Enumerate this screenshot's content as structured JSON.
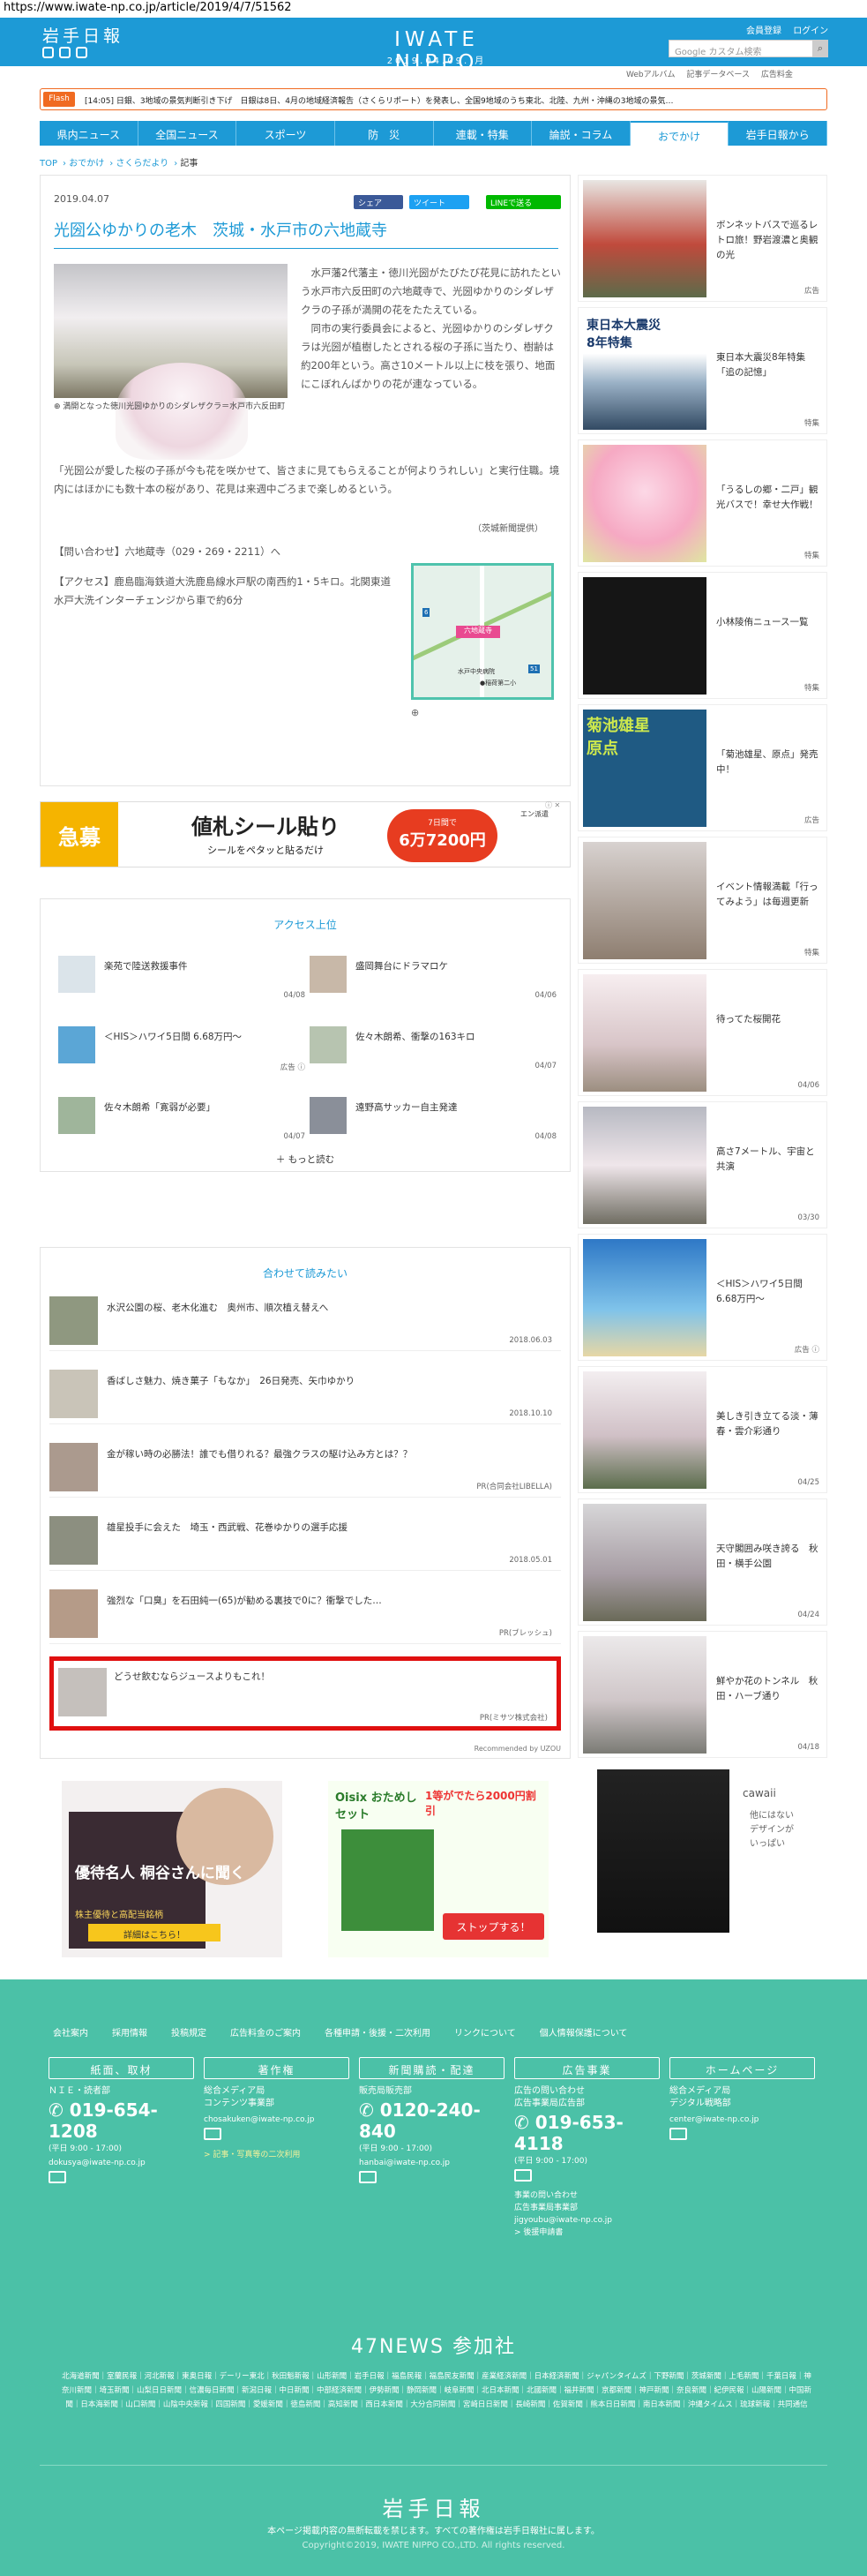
{
  "url": "https://www.iwate-np.co.jp/article/2019/4/7/51562",
  "header": {
    "logo": "岩手日報",
    "brand": "IWATE NIPPO",
    "date": "2019.04.09. 月",
    "account": [
      "会員登録",
      "ログイン"
    ],
    "search_placeholder": "Google カスタム検索",
    "subnav": [
      "Webアルバム",
      "記事データベース",
      "広告料金"
    ]
  },
  "flash": {
    "tag": "Flash",
    "text": "[14:05] 日銀、3地域の景気判断引き下げ　日銀は8日、4月の地域経済報告（さくらリポート）を発表し、全国9地域のうち東北、北陸、九州・沖縄の3地域の景気…"
  },
  "nav": [
    "県内ニュース",
    "全国ニュース",
    "スポーツ",
    "防　災",
    "連載・特集",
    "論説・コラム",
    "おでかけ",
    "岩手日報から"
  ],
  "breadcrumb": [
    "TOP",
    "おでかけ",
    "さくらだより",
    "記事"
  ],
  "article": {
    "date": "2019.04.07",
    "share": [
      "シェア",
      "ツイート",
      "LINEで送る"
    ],
    "title": "光圀公ゆかりの老木　茨城・水戸市の六地蔵寺",
    "photo_caption": "満開となった徳川光圀ゆかりのシダレザクラ＝水戸市六反田町",
    "body1": "　水戸藩2代藩主・徳川光圀がたびたび花見に訪れたという水戸市六反田町の六地蔵寺で、光圀ゆかりのシダレザクラの子孫が満開の花をたたえている。\n　同市の実行委員会によると、光圀ゆかりのシダレザクラは光圀が植樹したとされる桜の子孫に当たり、樹齢は約200年という。高さ10メートル以上に枝を張り、地面にこぼれんばかりの花が連なっている。",
    "body2": "「光圀公が愛した桜の子孫が今も花を咲かせて、皆さまに見てもらえることが何よりうれしい」と実行住職。境内にはほかにも数十本の桜があり、花見は来週中ごろまで楽しめるという。",
    "credit": "（茨城新聞提供）",
    "contact": "【問い合わせ】六地蔵寺（029・269・2211）へ",
    "access": "【アクセス】鹿島臨海鉄道大洗鹿島線水戸駅の南西約1・5キロ。北関東道水戸大洗インターチェンジから車で約6分",
    "map_marker": "六地蔵寺",
    "map_labels": [
      "水戸中央病院",
      "●稲荷第二小",
      "6",
      "51"
    ]
  },
  "ad1": {
    "tag": "急募",
    "main": "値札シール貼り",
    "sub": "シールをペタッと貼るだけ",
    "price_small": "7日間で",
    "price": "6万7200円",
    "logo": "エン派遣"
  },
  "ranking": {
    "title": "アクセス上位",
    "items": [
      {
        "text": "楽苑で陸送救援事件",
        "date": "04/08"
      },
      {
        "text": "盛岡舞台にドラマロケ",
        "date": "04/06"
      },
      {
        "text": "＜HIS＞ハワイ5日間 6.68万円〜",
        "date": "広告 ⓘ"
      },
      {
        "text": "佐々木朗希、衝撃の163キロ",
        "date": "04/07"
      },
      {
        "text": "佐々木朗希「寛弱が必要」",
        "date": "04/07"
      },
      {
        "text": "遠野高サッカー自主発達",
        "date": "04/08"
      }
    ],
    "more": "もっと読む"
  },
  "recs": {
    "title": "合わせて読みたい",
    "items": [
      {
        "text": "水沢公園の桜、老木化進む　奥州市、順次植え替えへ",
        "meta": "2018.06.03"
      },
      {
        "text": "香ばしさ魅力、焼き菓子「もなか」　26日発売、矢巾ゆかり",
        "meta": "2018.10.10"
      },
      {
        "text": "金が稼い時の必勝法！誰でも借りれる？最強クラスの駆け込み方とは？？",
        "meta": "PR(合同会社LIBELLA)"
      },
      {
        "text": "雄星投手に会えた　埼玉・西武戦、花巻ゆかりの選手応援",
        "meta": "2018.05.01"
      },
      {
        "text": "強烈な「口臭」を石田純一(65)が勧める裏技で0に？衝撃でした…",
        "meta": "PR(ブレッシュ)"
      },
      {
        "text": "どうせ飲むならジュースよりもこれ！",
        "meta": "PR(ミサツ株式会社)"
      }
    ],
    "recommended": "Recommended by UZOU"
  },
  "ads_bottom": [
    {
      "title": "優待名人 桐谷さんに聞く",
      "sub": "株主優待と高配当銘柄",
      "cta": "詳細はこちら！"
    },
    {
      "title": "Oisix おためしセット",
      "sub": "1等がでたら2000円割引",
      "cta": "ストップする！"
    },
    {
      "title": "cawaii",
      "sub": "他にはないデザインがいっぱい"
    }
  ],
  "sidebar": [
    {
      "text": "ボンネットバスで巡るレトロ旅！野岩渡濃と奥観の光",
      "date": "広告"
    },
    {
      "text": "東日本大震災8年特集「追の記憶」",
      "date": "特集"
    },
    {
      "text": "「うるしの郷・二戸」観光バスで！幸せ大作戦！",
      "date": "特集"
    },
    {
      "text": "小林陵侑ニュース一覧",
      "date": "特集"
    },
    {
      "text": "「菊池雄星、原点」発売中！",
      "date": "広告"
    },
    {
      "text": "イベント情報満載「行ってみよう」は毎週更新",
      "date": "特集"
    },
    {
      "text": "待ってた桜開花",
      "date": "04/06"
    },
    {
      "text": "高さ7メートル、宇宙と共演",
      "date": "03/30"
    },
    {
      "text": "＜HIS＞ハワイ5日間 6.68万円〜",
      "date": "広告 ⓘ"
    },
    {
      "text": "美しき引き立てる淡・薄春・雲介彩通り",
      "date": "04/25"
    },
    {
      "text": "天守閣囲み咲き誇る　秋田・横手公園",
      "date": "04/24"
    },
    {
      "text": "鮮やか花のトンネル　秋田・ハーブ通り",
      "date": "04/18"
    }
  ],
  "sidebar_titles": [
    "東日本大震災\n8年特集",
    "菊池雄星\n原点"
  ],
  "footer": {
    "links": [
      "会社案内",
      "採用情報",
      "投稿規定",
      "広告料金のご案内",
      "各種申請・後援・二次利用",
      "リンクについて",
      "個人情報保護について"
    ],
    "boxes": [
      {
        "head": "紙面、取材",
        "line": "ＮＩＥ・読者部",
        "tel": "019-654-1208",
        "hours": "(平日 9:00 - 17:00)",
        "mail": "dokusya@iwate-np.co.jp"
      },
      {
        "head": "著作権",
        "line": "総合メディア局\nコンテンツ事業部",
        "tel": "",
        "hours": "",
        "mail": "chosakuken@iwate-np.co.jp",
        "extra": "> 記事・写真等の二次利用"
      },
      {
        "head": "新聞購読・配達",
        "line": "販売局販売部",
        "tel": "0120-240-840",
        "hours": "(平日 9:00 - 17:00)",
        "mail": "hanbai@iwate-np.co.jp"
      },
      {
        "head": "広告事業",
        "line": "広告の問い合わせ\n広告事業局広告部",
        "tel": "019-653-4118",
        "hours": "(平日 9:00 - 17:00)",
        "mail": "",
        "extra": "事業の問い合わせ\n広告事業局事業部\njigyoubu@iwate-np.co.jp\n> 後援申請書"
      },
      {
        "head": "ホームページ",
        "line": "総合メディア局\nデジタル戦略部",
        "tel": "",
        "hours": "",
        "mail": "center@iwate-np.co.jp"
      }
    ],
    "n47_title": "47NEWS 参加社",
    "n47_list": "北海道新聞｜室蘭民報｜河北新報｜東奥日報｜デーリー東北｜秋田魁新報｜山形新聞｜岩手日報｜福島民報｜福島民友新聞｜産業経済新聞｜日本経済新聞｜ジャパンタイムズ｜下野新聞｜茨城新聞｜上毛新聞｜千葉日報｜神奈川新聞｜埼玉新聞｜山梨日日新聞｜信濃毎日新聞｜新潟日報｜中日新聞｜中部経済新聞｜伊勢新聞｜静岡新聞｜岐阜新聞｜北日本新聞｜北國新聞｜福井新聞｜京都新聞｜神戸新聞｜奈良新聞｜紀伊民報｜山陽新聞｜中国新聞｜日本海新聞｜山口新聞｜山陰中央新報｜四国新聞｜愛媛新聞｜徳島新聞｜高知新聞｜西日本新聞｜大分合同新聞｜宮崎日日新聞｜長崎新聞｜佐賀新聞｜熊本日日新聞｜南日本新聞｜沖縄タイムス｜琉球新報｜共同通信",
    "logo": "岩手日報",
    "copy1": "本ページ掲載内容の無断転載を禁じます。すべての著作権は岩手日報社に属します。",
    "copy2": "Copyright©2019, IWATE NIPPO CO.,LTD. All rights reserved."
  }
}
